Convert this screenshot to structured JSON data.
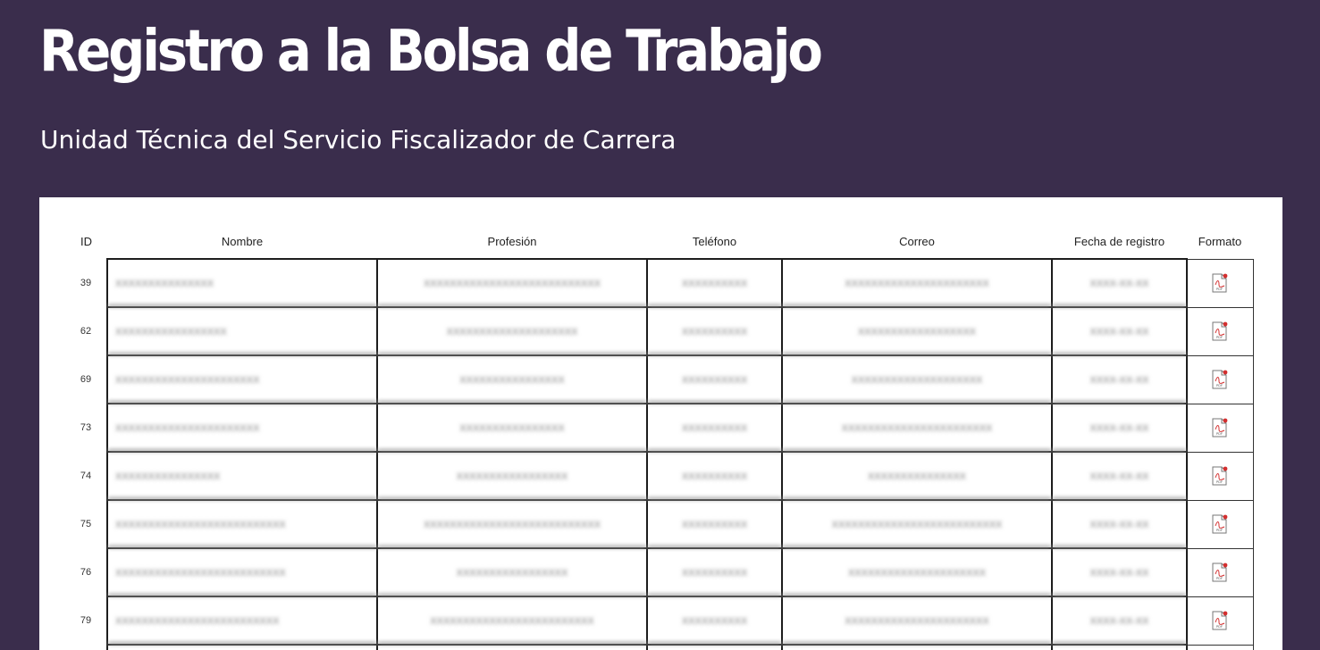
{
  "header": {
    "title": "Registro a la Bolsa de Trabajo",
    "subtitle": "Unidad Técnica del Servicio Fiscalizador de Carrera"
  },
  "table": {
    "columns": [
      "ID",
      "Nombre",
      "Profesión",
      "Teléfono",
      "Correo",
      "Fecha de registro",
      "Formato"
    ],
    "rows": [
      {
        "id": "39",
        "nombre": "XXXXXXXXXXXXXXX",
        "profesion": "XXXXXXXXXXXXXXXXXXXXXXXXXXX",
        "telefono": "XXXXXXXXXX",
        "correo": "XXXXXXXXXXXXXXXXXXXXXX",
        "fecha": "XXXX-XX-XX",
        "formato_icon": "pdf-icon"
      },
      {
        "id": "62",
        "nombre": "XXXXXXXXXXXXXXXXX",
        "profesion": "XXXXXXXXXXXXXXXXXXXX",
        "telefono": "XXXXXXXXXX",
        "correo": "XXXXXXXXXXXXXXXXXX",
        "fecha": "XXXX-XX-XX",
        "formato_icon": "pdf-icon"
      },
      {
        "id": "69",
        "nombre": "XXXXXXXXXXXXXXXXXXXXXX",
        "profesion": "XXXXXXXXXXXXXXXX",
        "telefono": "XXXXXXXXXX",
        "correo": "XXXXXXXXXXXXXXXXXXXX",
        "fecha": "XXXX-XX-XX",
        "formato_icon": "pdf-icon"
      },
      {
        "id": "73",
        "nombre": "XXXXXXXXXXXXXXXXXXXXXX",
        "profesion": "XXXXXXXXXXXXXXXX",
        "telefono": "XXXXXXXXXX",
        "correo": "XXXXXXXXXXXXXXXXXXXXXXX",
        "fecha": "XXXX-XX-XX",
        "formato_icon": "pdf-icon"
      },
      {
        "id": "74",
        "nombre": "XXXXXXXXXXXXXXXX",
        "profesion": "XXXXXXXXXXXXXXXXX",
        "telefono": "XXXXXXXXXX",
        "correo": "XXXXXXXXXXXXXXX",
        "fecha": "XXXX-XX-XX",
        "formato_icon": "pdf-icon"
      },
      {
        "id": "75",
        "nombre": "XXXXXXXXXXXXXXXXXXXXXXXXXX",
        "profesion": "XXXXXXXXXXXXXXXXXXXXXXXXXXX",
        "telefono": "XXXXXXXXXX",
        "correo": "XXXXXXXXXXXXXXXXXXXXXXXXXX",
        "fecha": "XXXX-XX-XX",
        "formato_icon": "pdf-icon"
      },
      {
        "id": "76",
        "nombre": "XXXXXXXXXXXXXXXXXXXXXXXXXX",
        "profesion": "XXXXXXXXXXXXXXXXX",
        "telefono": "XXXXXXXXXX",
        "correo": "XXXXXXXXXXXXXXXXXXXXX",
        "fecha": "XXXX-XX-XX",
        "formato_icon": "pdf-icon"
      },
      {
        "id": "79",
        "nombre": "XXXXXXXXXXXXXXXXXXXXXXXXX",
        "profesion": "XXXXXXXXXXXXXXXXXXXXXXXXX",
        "telefono": "XXXXXXXXXX",
        "correo": "XXXXXXXXXXXXXXXXXXXXXX",
        "fecha": "XXXX-XX-XX",
        "formato_icon": "pdf-icon"
      }
    ]
  },
  "colors": {
    "page_background": "#3a2d4c",
    "panel_background": "#ffffff",
    "title_text": "#ffffff",
    "pdf_red": "#d32f2f"
  }
}
